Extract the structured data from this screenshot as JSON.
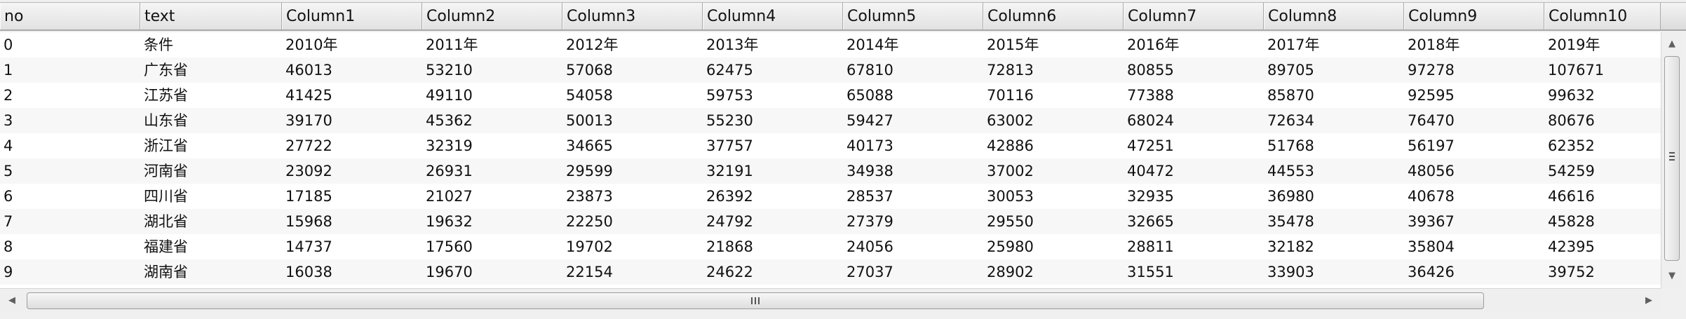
{
  "columns": [
    "no",
    "text",
    "Column1",
    "Column2",
    "Column3",
    "Column4",
    "Column5",
    "Column6",
    "Column7",
    "Column8",
    "Column9",
    "Column10"
  ],
  "rows": [
    [
      "0",
      "条件",
      "2010年",
      "2011年",
      "2012年",
      "2013年",
      "2014年",
      "2015年",
      "2016年",
      "2017年",
      "2018年",
      "2019年"
    ],
    [
      "1",
      "广东省",
      "46013",
      "53210",
      "57068",
      "62475",
      "67810",
      "72813",
      "80855",
      "89705",
      "97278",
      "107671"
    ],
    [
      "2",
      "江苏省",
      "41425",
      "49110",
      "54058",
      "59753",
      "65088",
      "70116",
      "77388",
      "85870",
      "92595",
      "99632"
    ],
    [
      "3",
      "山东省",
      "39170",
      "45362",
      "50013",
      "55230",
      "59427",
      "63002",
      "68024",
      "72634",
      "76470",
      "80676"
    ],
    [
      "4",
      "浙江省",
      "27722",
      "32319",
      "34665",
      "37757",
      "40173",
      "42886",
      "47251",
      "51768",
      "56197",
      "62352"
    ],
    [
      "5",
      "河南省",
      "23092",
      "26931",
      "29599",
      "32191",
      "34938",
      "37002",
      "40472",
      "44553",
      "48056",
      "54259"
    ],
    [
      "6",
      "四川省",
      "17185",
      "21027",
      "23873",
      "26392",
      "28537",
      "30053",
      "32935",
      "36980",
      "40678",
      "46616"
    ],
    [
      "7",
      "湖北省",
      "15968",
      "19632",
      "22250",
      "24792",
      "27379",
      "29550",
      "32665",
      "35478",
      "39367",
      "45828"
    ],
    [
      "8",
      "福建省",
      "14737",
      "17560",
      "19702",
      "21868",
      "24056",
      "25980",
      "28811",
      "32182",
      "35804",
      "42395"
    ],
    [
      "9",
      "湖南省",
      "16038",
      "19670",
      "22154",
      "24622",
      "27037",
      "28902",
      "31551",
      "33903",
      "36426",
      "39752"
    ]
  ],
  "icons": {
    "scroll_up": "triangle-up-icon",
    "scroll_down": "triangle-down-icon",
    "scroll_left": "triangle-left-icon",
    "scroll_right": "triangle-right-icon",
    "grip": "grip-icon"
  },
  "colors": {
    "header_bg": "#e2e2e2",
    "row_alt": "#f7f7f7",
    "grid_border": "#a9a9a9"
  }
}
